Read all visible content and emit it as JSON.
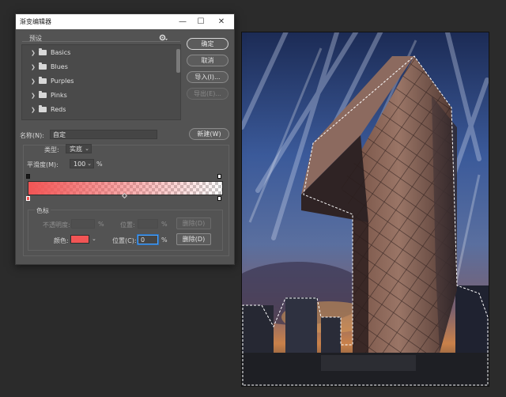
{
  "dialog": {
    "title": "渐变编辑器",
    "window_controls": {
      "minimize": "—",
      "maximize": "☐",
      "close": "✕"
    },
    "buttons": {
      "ok": "确定",
      "cancel": "取消",
      "import": "导入(I)...",
      "export": "导出(E)..."
    },
    "presets": {
      "label": "预设",
      "gear_icon": "gear-icon",
      "items": [
        {
          "label": "Basics"
        },
        {
          "label": "Blues"
        },
        {
          "label": "Purples"
        },
        {
          "label": "Pinks"
        },
        {
          "label": "Reds"
        }
      ]
    },
    "name": {
      "label": "名称(N):",
      "value": "自定",
      "new_button": "新建(W)"
    },
    "type": {
      "label": "类型:",
      "value": "实底"
    },
    "smoothness": {
      "label": "平滑度(M):",
      "value": "100",
      "unit": "%"
    },
    "gradient": {
      "start_color": "#f25555",
      "end_opacity": 0
    },
    "stops": {
      "group_label": "色标",
      "opacity_label": "不透明度:",
      "opacity_unit": "%",
      "opacity_location_label": "位置:",
      "opacity_location_unit": "%",
      "opacity_delete": "删除(D)",
      "color_label": "颜色:",
      "color_value": "#f25555",
      "location_label": "位置(C):",
      "location_value": "0",
      "location_unit": "%",
      "color_delete": "删除(D)"
    }
  }
}
